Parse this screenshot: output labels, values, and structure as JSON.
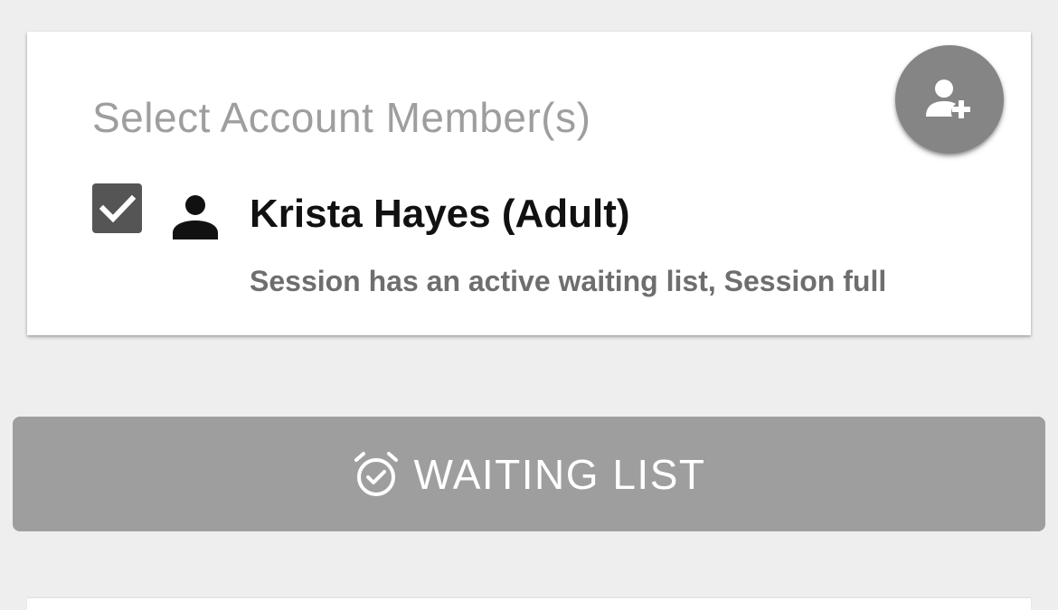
{
  "member_card": {
    "title": "Select Account Member(s)",
    "add_member_icon": "person-add-icon",
    "members": [
      {
        "name": "Krista Hayes (Adult)",
        "status": "Session has an active waiting list, Session full",
        "checked": true,
        "icon": "person-icon"
      }
    ]
  },
  "waiting_list_button": {
    "label": "WAITING LIST",
    "icon": "alarm-check-icon"
  },
  "colors": {
    "background": "#eeeeee",
    "card": "#ffffff",
    "fab": "#858585",
    "checkbox": "#555555",
    "button": "#9e9e9e",
    "title_text": "#9e9e9e",
    "status_text": "#6e6e6e"
  }
}
